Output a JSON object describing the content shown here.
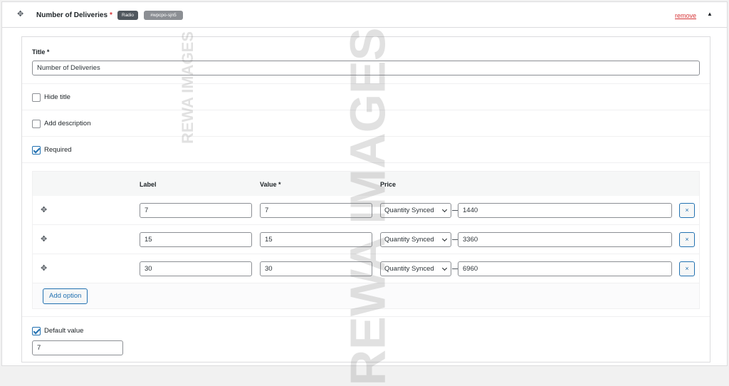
{
  "header": {
    "field_title": "Number of Deliveries",
    "required_mark": "*",
    "type_badge": "Radio",
    "id_badge": "#wpcpo-sjn5",
    "remove_label": "remove"
  },
  "title_field": {
    "label": "Title *",
    "value": "Number of Deliveries"
  },
  "checkboxes": {
    "hide_title": {
      "label": "Hide title",
      "checked": false
    },
    "add_description": {
      "label": "Add description",
      "checked": false
    },
    "required": {
      "label": "Required",
      "checked": true
    }
  },
  "options_table": {
    "columns": [
      "Label",
      "Value *",
      "Price"
    ],
    "rows": [
      {
        "label": "7",
        "value": "7",
        "price_type": "Quantity Synced",
        "price": "1440"
      },
      {
        "label": "15",
        "value": "15",
        "price_type": "Quantity Synced",
        "price": "3360"
      },
      {
        "label": "30",
        "value": "30",
        "price_type": "Quantity Synced",
        "price": "6960"
      }
    ],
    "delete_label": "×",
    "add_option_label": "Add option"
  },
  "default_value": {
    "label": "Default value",
    "checked": true,
    "value": "7"
  },
  "watermark": {
    "big": "REWA IMAGES",
    "small": "REWA IMAGES"
  },
  "icons": {
    "drag": "✥",
    "collapse": "▲"
  }
}
